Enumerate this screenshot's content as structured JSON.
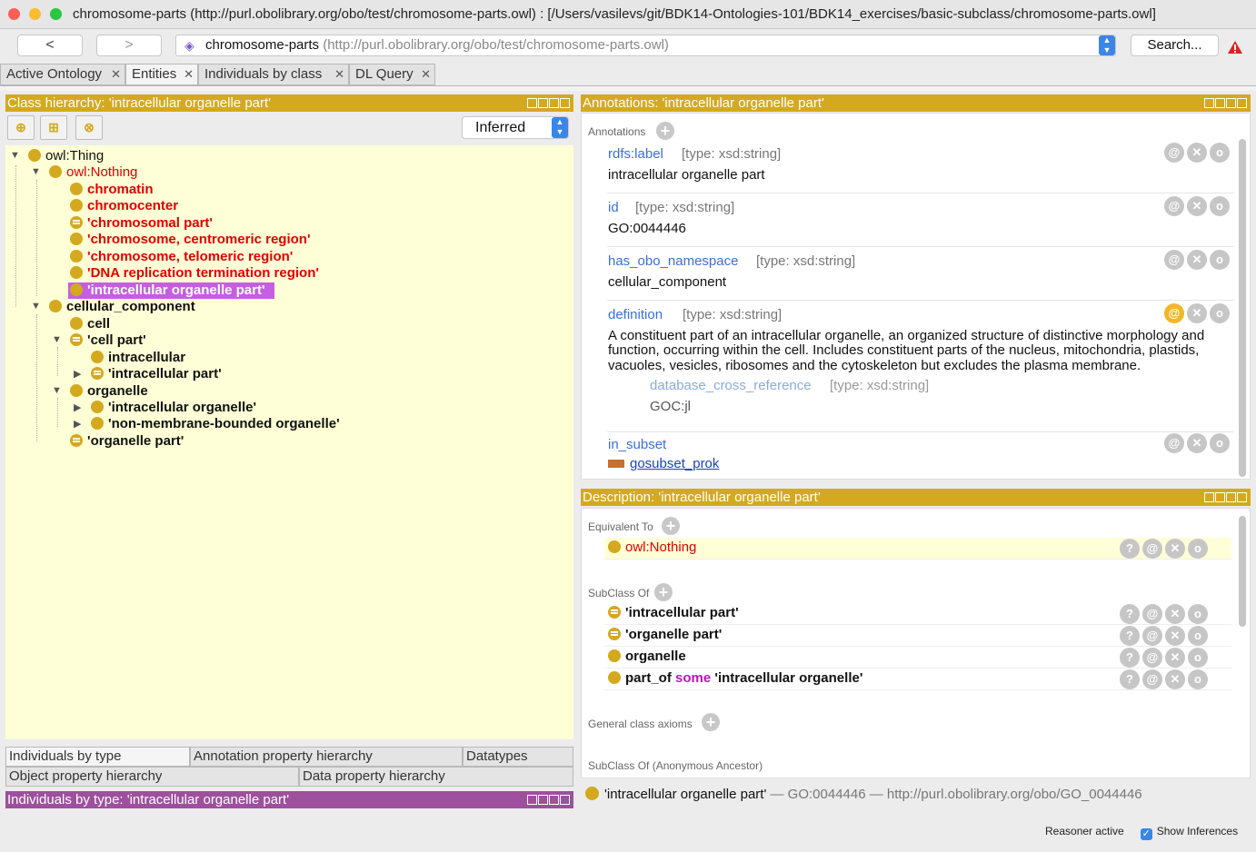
{
  "window": {
    "title": "chromosome-parts (http://purl.obolibrary.org/obo/test/chromosome-parts.owl)  : [/Users/vasilevs/git/BDK14-Ontologies-101/BDK14_exercises/basic-subclass/chromosome-parts.owl]"
  },
  "nav": {
    "back": "<",
    "forward": ">",
    "ontology_name": "chromosome-parts",
    "ontology_iri": "(http://purl.obolibrary.org/obo/test/chromosome-parts.owl)",
    "search": "Search..."
  },
  "tabs": [
    {
      "label": "Active Ontology"
    },
    {
      "label": "Entities"
    },
    {
      "label": "Individuals by class"
    },
    {
      "label": "DL Query"
    }
  ],
  "class_hierarchy": {
    "header": "Class hierarchy: 'intracellular organelle part'",
    "reasoner_mode": "Inferred",
    "nodes": [
      "owl:Thing",
      "owl:Nothing",
      "chromatin",
      "chromocenter",
      "'chromosomal part'",
      "'chromosome, centromeric region'",
      "'chromosome, telomeric region'",
      "'DNA replication termination region'",
      "'intracellular organelle part'",
      "cellular_component",
      "cell",
      "'cell part'",
      "intracellular",
      "'intracellular part'",
      "organelle",
      "'intracellular organelle'",
      "'non-membrane-bounded organelle'",
      "'organelle part'"
    ]
  },
  "bottom_tabs": {
    "row1": [
      "Individuals by type",
      "Annotation property hierarchy",
      "Datatypes"
    ],
    "row2": [
      "Object property hierarchy",
      "Data property hierarchy"
    ]
  },
  "individuals_header": "Individuals by type: 'intracellular organelle part'",
  "annotations": {
    "header": "Annotations: 'intracellular organelle part'",
    "section_label": "Annotations",
    "items": [
      {
        "property": "rdfs:label",
        "type": "[type: xsd:string]",
        "value": "intracellular organelle part"
      },
      {
        "property": "id",
        "type": "[type: xsd:string]",
        "value": "GO:0044446"
      },
      {
        "property": "has_obo_namespace",
        "type": "[type: xsd:string]",
        "value": "cellular_component"
      },
      {
        "property": "definition",
        "type": "[type: xsd:string]",
        "value_lines": [
          "A constituent part of an intracellular organelle, an organized structure of distinctive morphology and",
          "function, occurring within the cell. Includes constituent parts of the nucleus, mitochondria, plastids,",
          "vacuoles, vesicles, ribosomes and the cytoskeleton but excludes the plasma membrane."
        ],
        "nested": {
          "property": "database_cross_reference",
          "type": "[type: xsd:string]",
          "value": "GOC:jl"
        }
      },
      {
        "property": "in_subset",
        "value": "gosubset_prok"
      }
    ]
  },
  "description": {
    "header": "Description: 'intracellular organelle part'",
    "equivalent_label": "Equivalent To",
    "equivalent": [
      "owl:Nothing"
    ],
    "subclass_label": "SubClass Of",
    "subclass_of": [
      {
        "text": "'intracellular part'"
      },
      {
        "text": "'organelle part'"
      },
      {
        "text": "organelle"
      },
      {
        "prefix": "part_of",
        "keyword": "some",
        "filler": "'intracellular organelle'"
      }
    ],
    "general_label": "General class axioms",
    "anon_label": "SubClass Of (Anonymous Ancestor)"
  },
  "selected_entity": {
    "label": "'intracellular organelle part'",
    "id": "— GO:0044446 —",
    "iri": "http://purl.obolibrary.org/obo/GO_0044446"
  },
  "status": {
    "reasoner": "Reasoner active",
    "show_inferences": "Show Inferences"
  },
  "colors": {
    "class_dot": "#d4a91f",
    "header_gold": "#d4a91f",
    "header_purple": "#9e4f9d",
    "unsatisfiable_red": "#e00000",
    "selection": "#c55ee0",
    "link_blue": "#3a6fd8"
  }
}
